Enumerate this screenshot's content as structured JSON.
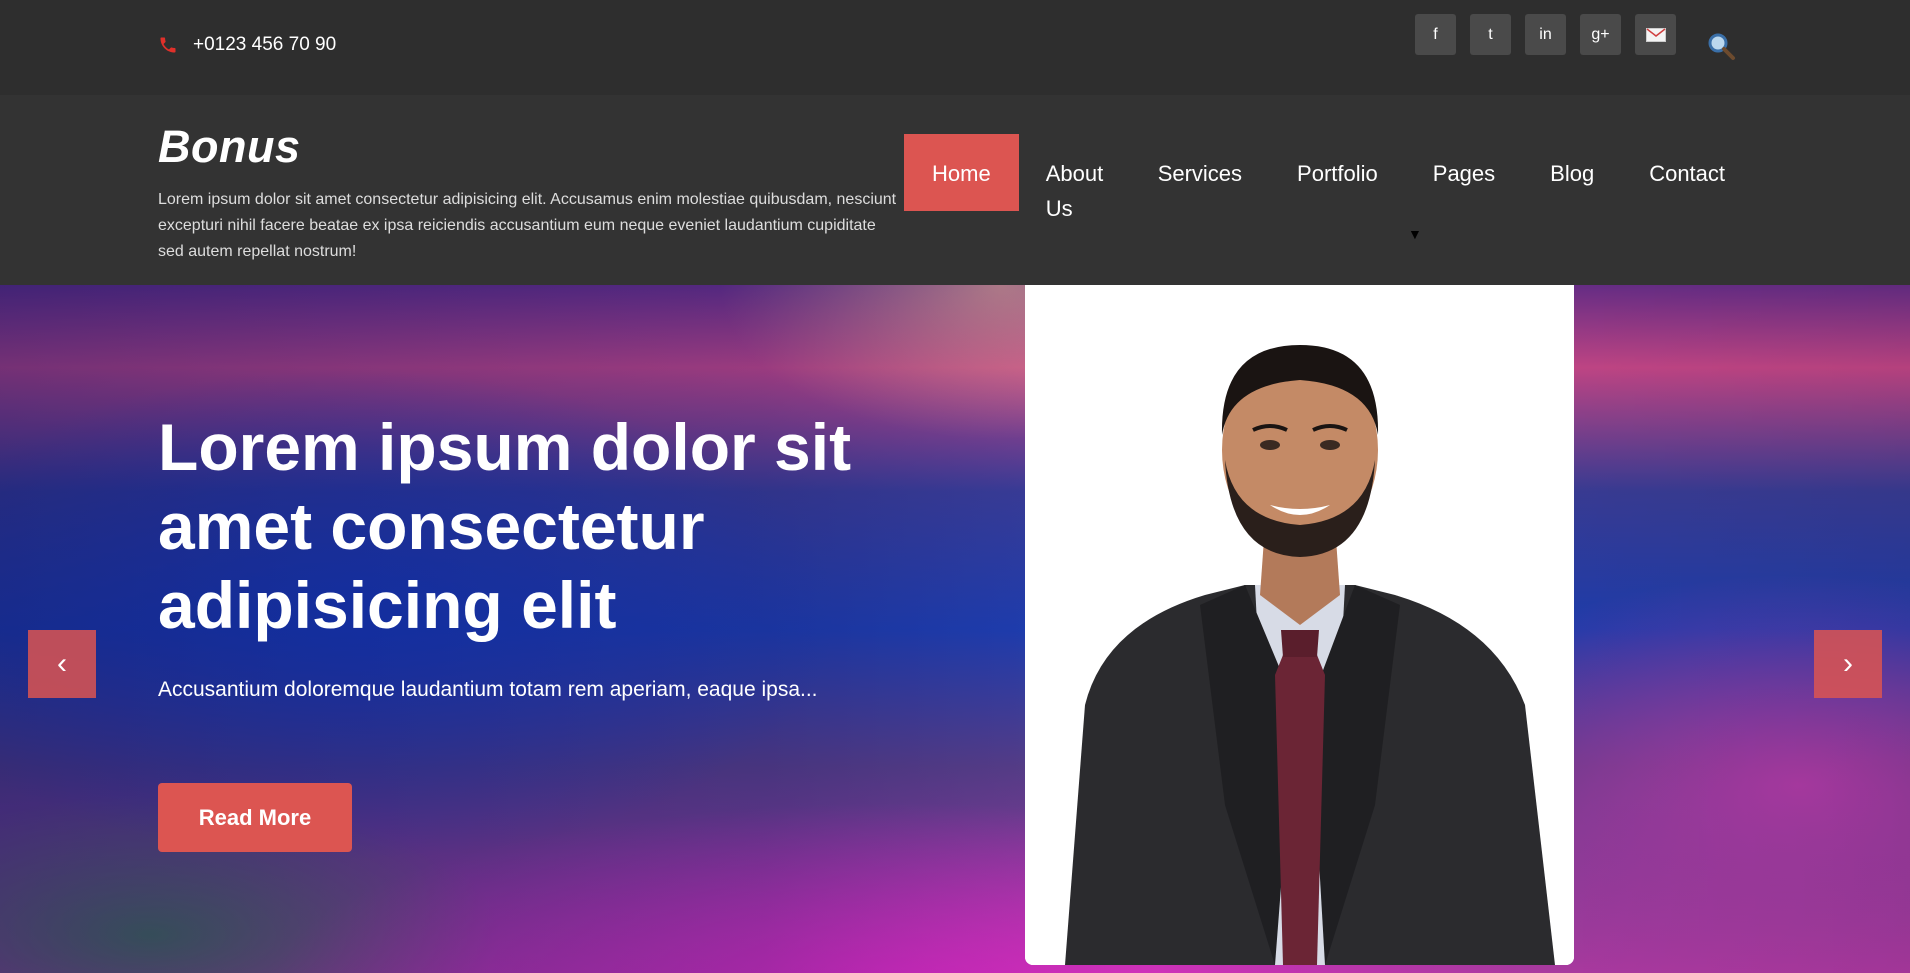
{
  "topbar": {
    "phone": "+0123 456 70 90",
    "social": [
      {
        "label": "f",
        "icon": "facebook-icon"
      },
      {
        "label": "t",
        "icon": "twitter-icon"
      },
      {
        "label": "in",
        "icon": "linkedin-icon"
      },
      {
        "label": "g+",
        "icon": "google-plus-icon"
      },
      {
        "label": "",
        "icon": "email-icon"
      }
    ]
  },
  "header": {
    "brand": "Bonus",
    "tagline": "Lorem ipsum dolor sit amet consectetur adipisicing elit. Accusamus enim molestiae quibusdam, nesciunt excepturi nihil facere beatae ex ipsa reiciendis accusantium eum neque eveniet laudantium cupiditate sed autem repellat nostrum!",
    "nav": {
      "home": "Home",
      "about": "About Us",
      "services": "Services",
      "portfolio": "Portfolio",
      "pages": "Pages",
      "blog": "Blog",
      "contact": "Contact",
      "dropdown_caret": "▼"
    }
  },
  "hero": {
    "title": "Lorem ipsum dolor sit amet consectetur adipisicing elit",
    "subtitle": "Accusantium doloremque laudantium totam rem aperiam, eaque ipsa...",
    "cta": "Read More",
    "prev": "‹",
    "next": "›"
  },
  "colors": {
    "accent": "#dc5551",
    "topbar_bg": "#2e2e2e",
    "header_bg": "#333333",
    "social_bg": "#4a4a4a"
  }
}
